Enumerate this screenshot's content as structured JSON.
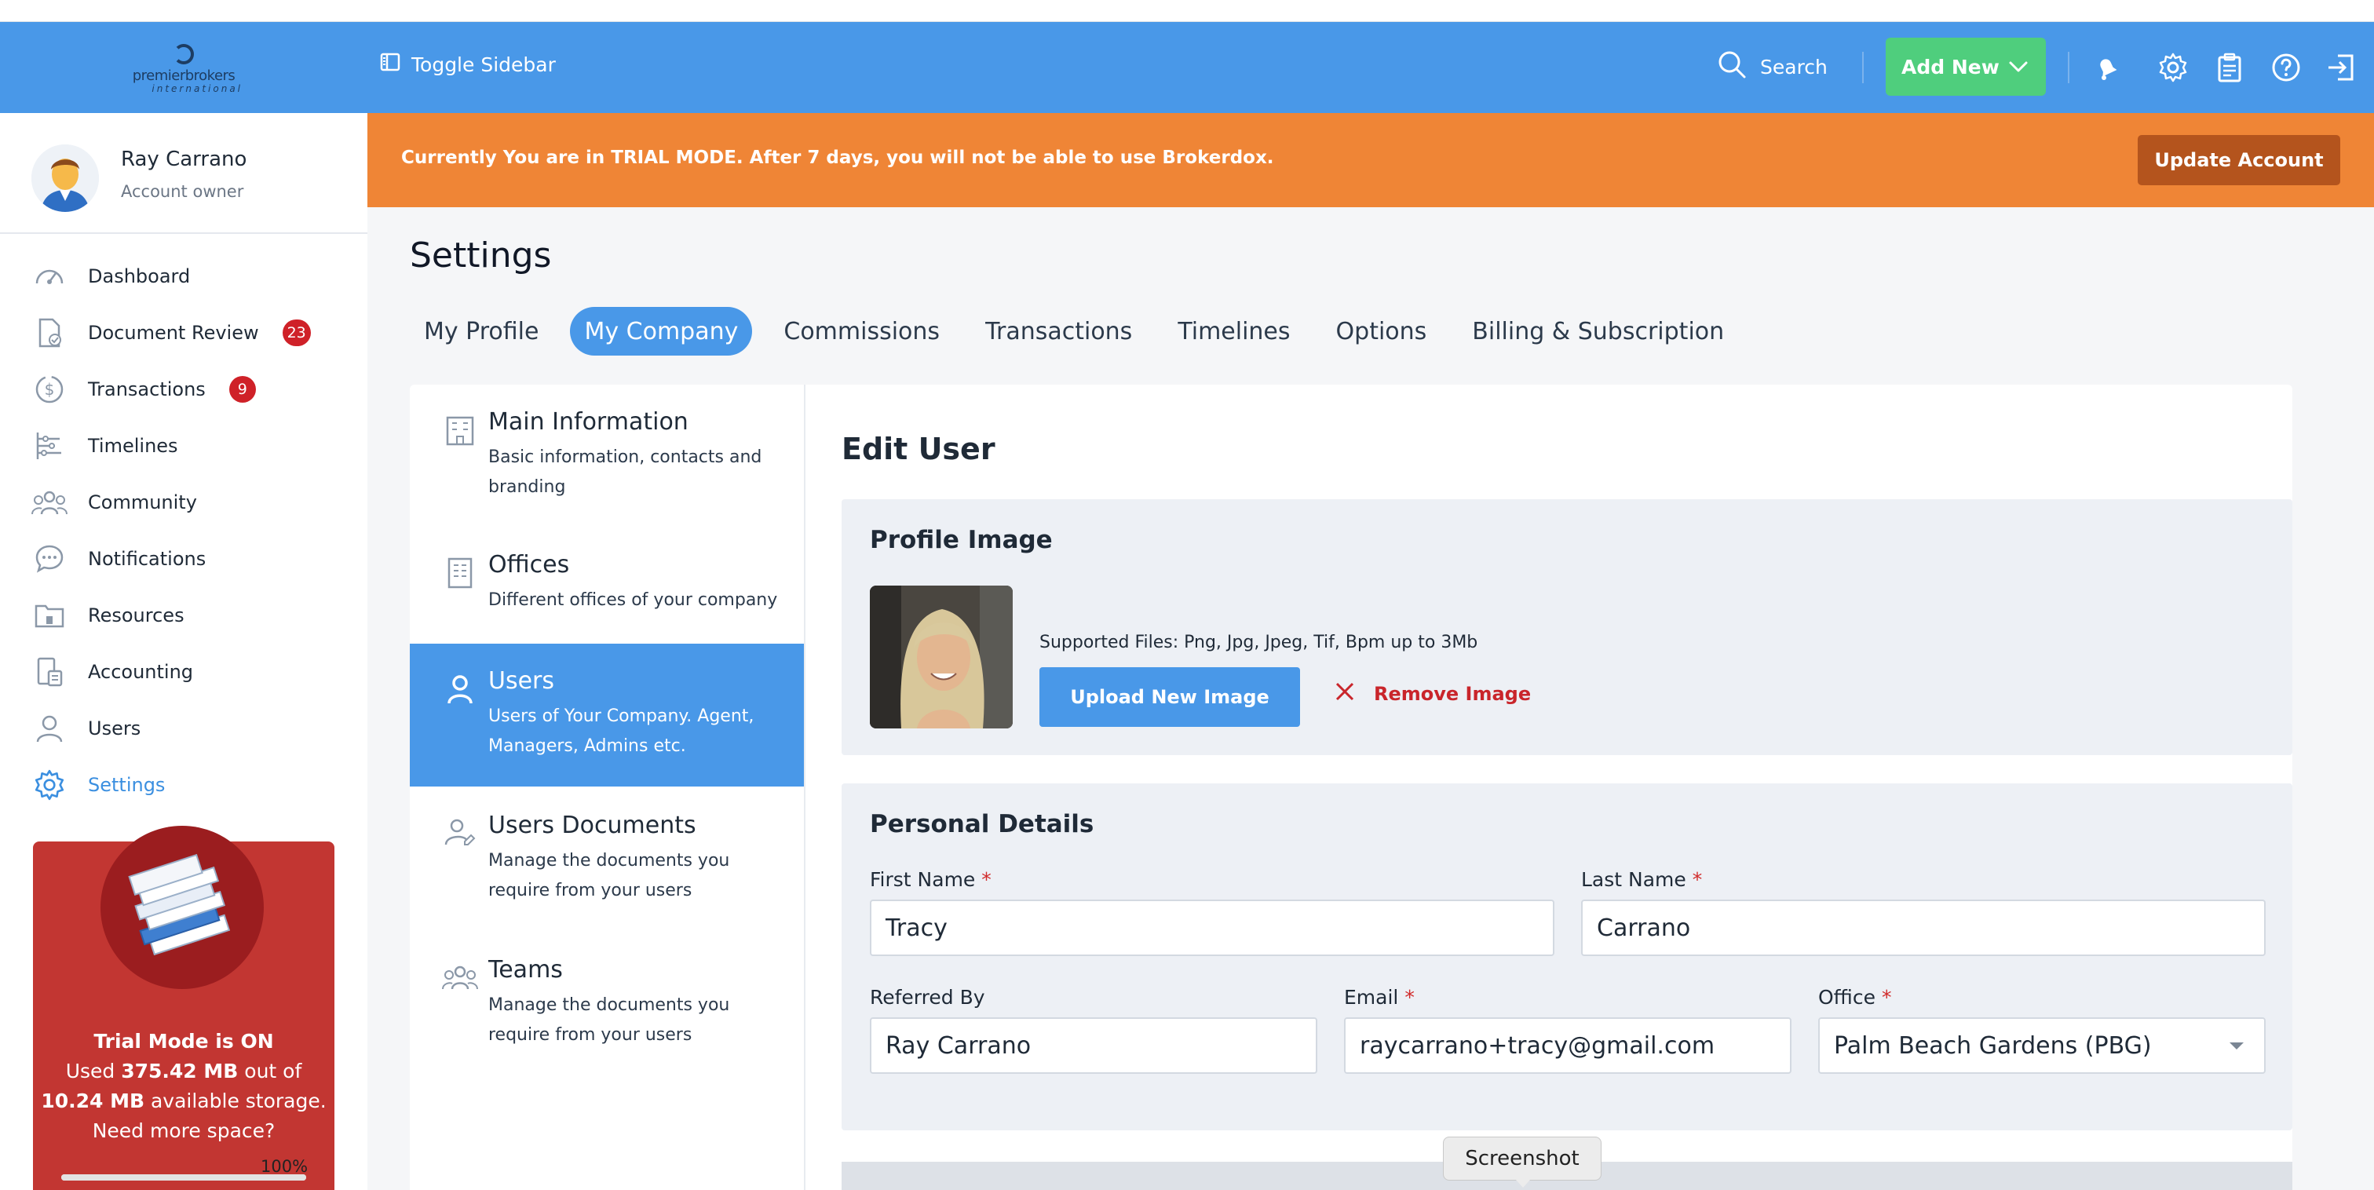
{
  "topbar": {
    "logo_text": "premierbrokers",
    "logo_subtext": "international",
    "toggle_label": "Toggle Sidebar",
    "search_label": "Search",
    "add_new_label": "Add New"
  },
  "user": {
    "name": "Ray Carrano",
    "role": "Account owner"
  },
  "sidebar": {
    "items": [
      {
        "label": "Dashboard",
        "icon": "speedometer-icon"
      },
      {
        "label": "Document Review",
        "icon": "document-check-icon",
        "badge": "23"
      },
      {
        "label": "Transactions",
        "icon": "dollar-circle-icon",
        "badge": "9"
      },
      {
        "label": "Timelines",
        "icon": "timeline-icon"
      },
      {
        "label": "Community",
        "icon": "people-group-icon"
      },
      {
        "label": "Notifications",
        "icon": "chat-bubble-icon"
      },
      {
        "label": "Resources",
        "icon": "folder-icon"
      },
      {
        "label": "Accounting",
        "icon": "calculator-icon"
      },
      {
        "label": "Users",
        "icon": "user-icon"
      },
      {
        "label": "Settings",
        "icon": "gear-icon",
        "active": true
      }
    ]
  },
  "trial_card": {
    "line1": "Trial Mode is ON",
    "used_prefix": "Used ",
    "used_value": "375.42 MB",
    "used_suffix": " out of",
    "total_value": "10.24 MB",
    "total_suffix": " available storage.",
    "cta": "Need more space?",
    "progress_label": "100%",
    "progress_fraction": 1.0
  },
  "banner": {
    "text": "Currently You are in TRIAL MODE. After 7 days, you will not be able to use Brokerdox.",
    "button_label": "Update Account",
    "color": "#ef8536"
  },
  "page": {
    "title": "Settings",
    "tabs": [
      {
        "label": "My Profile"
      },
      {
        "label": "My Company",
        "active": true
      },
      {
        "label": "Commissions"
      },
      {
        "label": "Transactions"
      },
      {
        "label": "Timelines"
      },
      {
        "label": "Options"
      },
      {
        "label": "Billing & Subscription"
      }
    ]
  },
  "subnav": {
    "items": [
      {
        "title": "Main Information",
        "desc": "Basic information, contacts and branding",
        "icon": "building-icon"
      },
      {
        "title": "Offices",
        "desc": "Different offices of your company",
        "icon": "office-building-icon"
      },
      {
        "title": "Users",
        "desc": "Users of Your Company. Agent, Managers, Admins etc.",
        "icon": "user-icon",
        "active": true
      },
      {
        "title": "Users Documents",
        "desc": "Manage the documents you require from your users",
        "icon": "user-document-icon"
      },
      {
        "title": "Teams",
        "desc": "Manage the documents you require from your users",
        "icon": "team-icon"
      }
    ]
  },
  "edit_user": {
    "title": "Edit User",
    "profile_image": {
      "title": "Profile Image",
      "supported": "Supported Files: Png, Jpg, Jpeg, Tif, Bpm up to 3Mb",
      "upload_label": "Upload New Image",
      "remove_label": "Remove Image"
    },
    "personal": {
      "title": "Personal Details",
      "first_name_label": "First Name",
      "first_name_value": "Tracy",
      "last_name_label": "Last Name",
      "last_name_value": "Carrano",
      "referred_by_label": "Referred By",
      "referred_by_value": "Ray Carrano",
      "email_label": "Email",
      "email_value": "raycarrano+tracy@gmail.com",
      "office_label": "Office",
      "office_value": "Palm Beach Gardens (PBG)",
      "required_mark": "*"
    }
  },
  "tooltip": {
    "text": "Screenshot"
  },
  "colors": {
    "primary": "#4998e8",
    "accent_green": "#4fce7d",
    "danger": "#c9252b",
    "badge": "#cf2128",
    "trial_card": "#c23632"
  }
}
